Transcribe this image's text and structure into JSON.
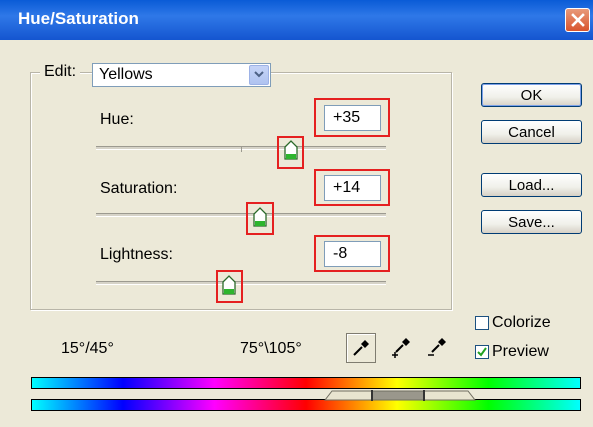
{
  "window": {
    "title": "Hue/Saturation"
  },
  "edit": {
    "label": "Edit:",
    "selected": "Yellows"
  },
  "hue": {
    "label": "Hue:",
    "value": "+35"
  },
  "saturation": {
    "label": "Saturation:",
    "value": "+14"
  },
  "lightness": {
    "label": "Lightness:",
    "value": "-8"
  },
  "buttons": {
    "ok": "OK",
    "cancel": "Cancel",
    "load": "Load...",
    "save": "Save..."
  },
  "options": {
    "colorize": "Colorize",
    "colorize_checked": false,
    "preview": "Preview",
    "preview_checked": true
  },
  "range": {
    "left": "15°/45°",
    "right": "75°\\105°"
  },
  "colors": {
    "title_bar": "#0A5BD6",
    "highlight": "#E52020",
    "dialog_bg": "#ECE9D8"
  }
}
